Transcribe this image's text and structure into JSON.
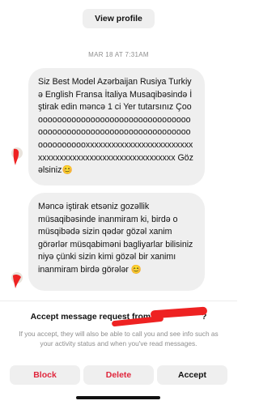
{
  "header": {
    "view_profile_label": "View profile"
  },
  "thread": {
    "timestamp": "MAR 18 AT 7:31AM",
    "messages": [
      {
        "text": "Siz Best Model Azərbaijan Rusiya Turkiyə English Fransa İtaliya Musaqibəsində İştirak edin məncə 1 ci Yer tutarsınız Çooooooooooooooooooooooooooooooooooooooooooooooooooooooooooooooooooooooooooooxxxxxxxxxxxxxxxxxxxxxxxxxxxxxxxxxxxxxxxxxxxxxxxxxxxxxxxxx Gözəlsiniz😊"
      },
      {
        "text": "Məncə iştirak etsəniz gozəllik müsaqibəsinde inanmiram ki, birdə o müsqibədə sizin qədər gözəl xanim görərlər müsqabiməni bagliyarlar bilisiniz niyə çünki sizin kimi gözəl bir xanimı inanmiram birdə görələr 😊"
      }
    ]
  },
  "request": {
    "title": "Accept message request from",
    "title_suffix": "?",
    "info": "If you accept, they will also be able to call you and see info such as your activity status and when you've read messages."
  },
  "actions": {
    "block": "Block",
    "delete": "Delete",
    "accept": "Accept"
  },
  "colors": {
    "destructive": "#e0263c",
    "bubble": "#efefef",
    "muted": "#8e8e8e",
    "redaction": "#e22222"
  }
}
